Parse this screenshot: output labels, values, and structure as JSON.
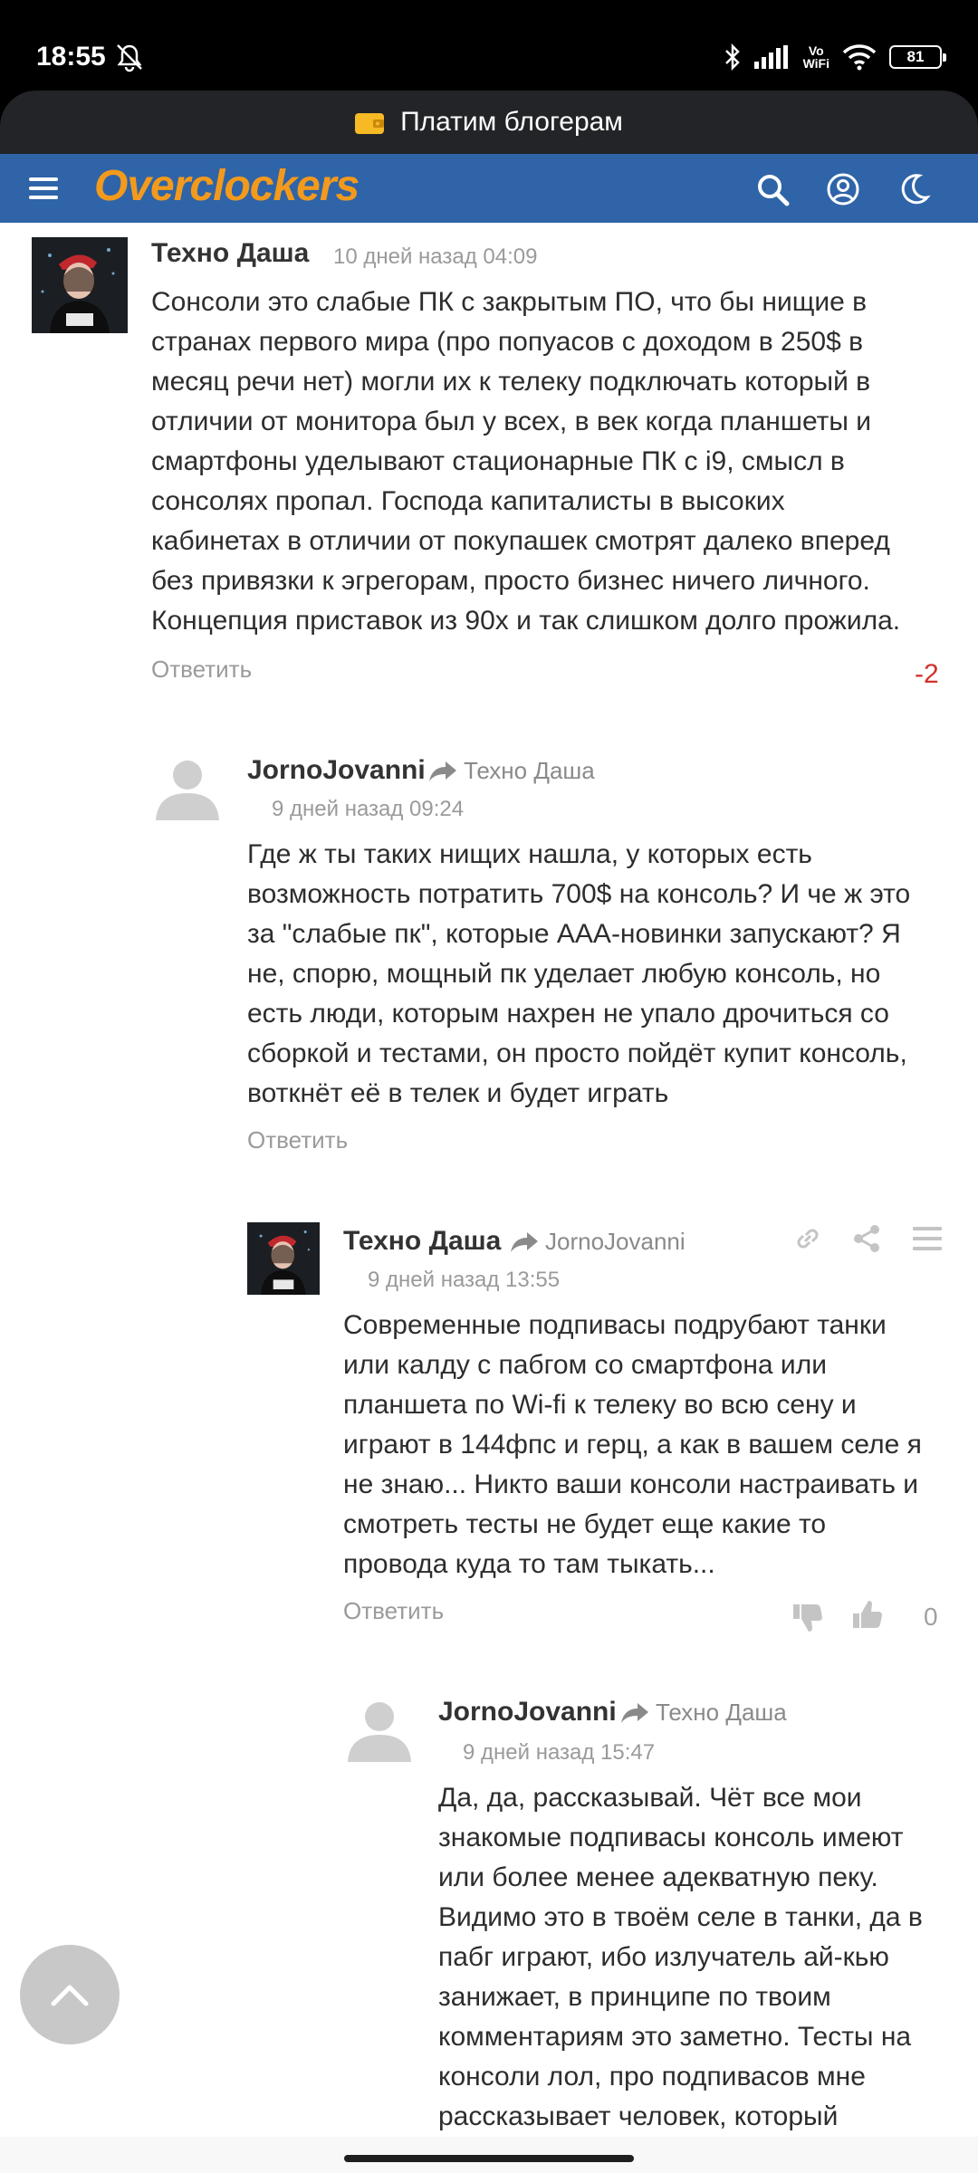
{
  "status_bar": {
    "time": "18:55",
    "battery": "81",
    "vowifi_top": "Vo",
    "vowifi_bottom": "WiFi",
    "icons": [
      "mute-notifications-icon",
      "bluetooth-icon",
      "signal-icon",
      "vowifi-icon",
      "wifi-icon",
      "battery-icon"
    ]
  },
  "banner": {
    "text": "Платим блогерам",
    "icon": "wallet-icon"
  },
  "header": {
    "logo": "Overclockers",
    "icons": [
      "menu-icon",
      "search-icon",
      "user-icon",
      "moon-icon"
    ],
    "colors": {
      "background": "#2f64a8",
      "logo": "#f39a1c"
    }
  },
  "comments": [
    {
      "author": "Техно Даша",
      "date": "10 дней назад 04:09",
      "lines": [
        "Сонсоли это слабые ПК с закрытым ПО, что бы нищие в",
        "странах первого мира (про попуасов с доходом в 250$ в",
        "месяц речи нет) могли их к телеку подключать который в",
        "отличии от монитора был у всех, в век когда планшеты и",
        "смартфоны уделывают стационарные ПК с i9, смысл в",
        "сонсолях пропал. Господа капиталисты в высоких",
        "кабинетах в отличии от покупашек смотрят далеко вперед",
        "без привязки к эгрегорам, просто бизнес ничего личного.",
        "Концепция приставок из 90х и так слишком долго прожила."
      ],
      "reply_label": "Ответить",
      "score": "-2"
    },
    {
      "author": "JornoJovanni",
      "reply_to": "Техно Даша",
      "date": "9 дней назад 09:24",
      "lines": [
        "Где ж ты таких нищих нашла, у которых есть",
        "возможность потратить 700$ на консоль? И че ж это",
        "за \"слабые пк\", которые ААА-новинки запускают? Я",
        "не, спорю, мощный пк уделает любую консоль, но",
        "есть люди, которым нахрен не упало дрочиться со",
        "сборкой и тестами, он просто пойдёт купит консоль,",
        "воткнёт её в телек и будет играть"
      ],
      "reply_label": "Ответить"
    },
    {
      "author": "Техно Даша",
      "reply_to": "JornoJovanni",
      "date": "9 дней назад 13:55",
      "lines": [
        "Современные подпивасы подрубают танки",
        "или калду с пабгом со смартфона или",
        "планшета по Wi-fi  к телеку во всю сену и",
        "играют в 144фпс и герц, а как в вашем селе я",
        "не знаю... Никто ваши консоли настраивать и",
        "смотреть тесты не будет еще какие то",
        "провода куда то там тыкать..."
      ],
      "reply_label": "Ответить",
      "score": "0",
      "action_icons": [
        "link-icon",
        "share-icon",
        "more-menu-icon",
        "dislike-icon",
        "like-icon"
      ]
    },
    {
      "author": "JornoJovanni",
      "reply_to": "Техно Даша",
      "date": "9 дней назад 15:47",
      "lines": [
        "Да, да, рассказывай. Чёт все мои",
        "знакомые подпивасы консоль имеют",
        "или более менее адекватную пеку.",
        "Видимо это в твоём селе в танки, да в",
        "пабг играют, ибо излучатель ай-кью",
        "занижает, в принципе по твоим",
        "комментариям это заметно. Тесты на",
        "консоли лол, про подпивасов мне",
        "рассказывает человек, который"
      ]
    }
  ]
}
